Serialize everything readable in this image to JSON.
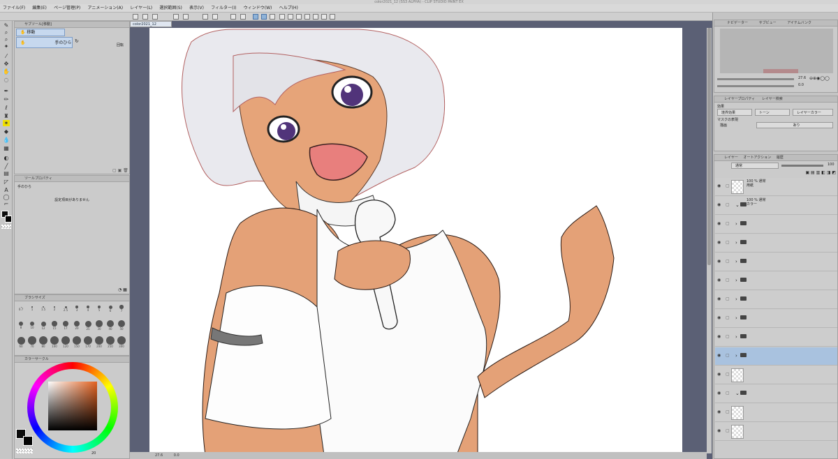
{
  "window": {
    "title": "color2021_12 (SS3 ALPHA) - CLIP STUDIO PAINT EX"
  },
  "menu": [
    "ファイル(F)",
    "編集(E)",
    "ページ管理(P)",
    "アニメーション(A)",
    "レイヤー(L)",
    "選択範囲(S)",
    "表示(V)",
    "フィルター(I)",
    "ウィンドウ(W)",
    "ヘルプ(H)"
  ],
  "document": {
    "tab": "color2021_12"
  },
  "subtool_panel": {
    "header": "サブツール[移動]",
    "group_tab": "移動",
    "selected_tool": "手のひら",
    "rotate_label": "回転"
  },
  "tool_property": {
    "header": "ツールプロパティ",
    "tool_name": "手のひら",
    "empty_message": "設定項目がありません"
  },
  "brush_size": {
    "header": "ブラシサイズ",
    "sizes": [
      "0.7",
      "1",
      "1.5",
      "2",
      "2.5",
      "3",
      "4",
      "5",
      "6",
      "7",
      "8",
      "10",
      "12",
      "15",
      "17",
      "20",
      "25",
      "30",
      "40",
      "50",
      "60",
      "70",
      "80",
      "100",
      "120",
      "150",
      "170",
      "200",
      "250",
      "300"
    ]
  },
  "color_circle": {
    "header": "カラーサークル",
    "fg_color": "#0b0b0b",
    "bg_color": "#050505",
    "hue_color": "#e3611f"
  },
  "status": {
    "zoom": "27.6",
    "angle": "0.0",
    "zoom2": "20"
  },
  "navigator": {
    "tabs": [
      "ナビゲーター",
      "サブビュー",
      "アイテムバンク"
    ]
  },
  "layer_property": {
    "tabs": [
      "レイヤープロパティ",
      "レイヤー検索"
    ],
    "effect_label": "効果",
    "effects": [
      "境界効果",
      "トーン",
      "レイヤーカラー"
    ],
    "mask_label": "マスクの表現",
    "mask_row_label": "描画",
    "mask_row_value": "あり"
  },
  "layer_panel": {
    "tabs": [
      "レイヤー",
      "オートアクション",
      "履歴"
    ],
    "blend_mode": "通常",
    "opacity": "100",
    "layers": [
      {
        "name": "100 % 通常\n用紙",
        "kind": "thumb"
      },
      {
        "name": "100 % 通常\nカラー",
        "kind": "folder-open"
      },
      {
        "name": "",
        "kind": "folder"
      },
      {
        "name": "",
        "kind": "folder"
      },
      {
        "name": "",
        "kind": "folder"
      },
      {
        "name": "",
        "kind": "folder"
      },
      {
        "name": "",
        "kind": "folder"
      },
      {
        "name": "",
        "kind": "folder"
      },
      {
        "name": "",
        "kind": "folder"
      },
      {
        "name": "",
        "kind": "folder",
        "selected": true
      },
      {
        "name": "",
        "kind": "thumb"
      },
      {
        "name": "",
        "kind": "folder-open"
      },
      {
        "name": "",
        "kind": "thumb"
      },
      {
        "name": "",
        "kind": "thumb"
      }
    ]
  }
}
